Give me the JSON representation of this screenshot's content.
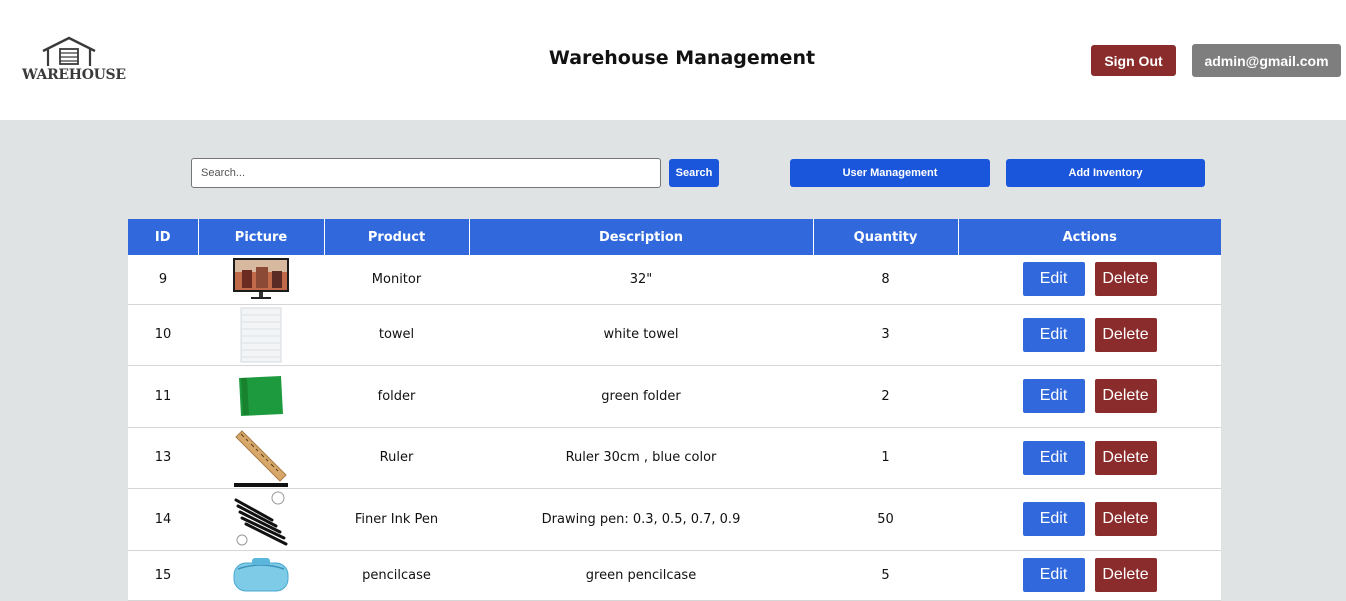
{
  "header": {
    "logo_text": "WAREHOUSE",
    "title": "Warehouse Management",
    "sign_out_label": "Sign Out",
    "user_email": "admin@gmail.com"
  },
  "toolbar": {
    "search_placeholder": "Search...",
    "search_label": "Search",
    "user_management_label": "User Management",
    "add_inventory_label": "Add Inventory"
  },
  "table": {
    "columns": [
      "ID",
      "Picture",
      "Product",
      "Description",
      "Quantity",
      "Actions"
    ],
    "edit_label": "Edit",
    "delete_label": "Delete",
    "rows": [
      {
        "id": "9",
        "picture": "monitor-image",
        "product": "Monitor",
        "description": "32\"",
        "quantity": "8"
      },
      {
        "id": "10",
        "picture": "towel-image",
        "product": "towel",
        "description": "white towel",
        "quantity": "3"
      },
      {
        "id": "11",
        "picture": "folder-image",
        "product": "folder",
        "description": "green folder",
        "quantity": "2"
      },
      {
        "id": "13",
        "picture": "ruler-image",
        "product": "Ruler",
        "description": "Ruler 30cm , blue color",
        "quantity": "1"
      },
      {
        "id": "14",
        "picture": "pen-image",
        "product": "Finer Ink Pen",
        "description": "Drawing pen: 0.3, 0.5, 0.7, 0.9",
        "quantity": "50"
      },
      {
        "id": "15",
        "picture": "pencilcase-image",
        "product": "pencilcase",
        "description": "green pencilcase",
        "quantity": "5"
      }
    ]
  },
  "colors": {
    "primary_blue": "#1a56db",
    "table_header_blue": "#3169dc",
    "danger_red": "#8b2c2c",
    "grey_button": "#7e7e7e",
    "page_bg": "#dfe3e4"
  }
}
